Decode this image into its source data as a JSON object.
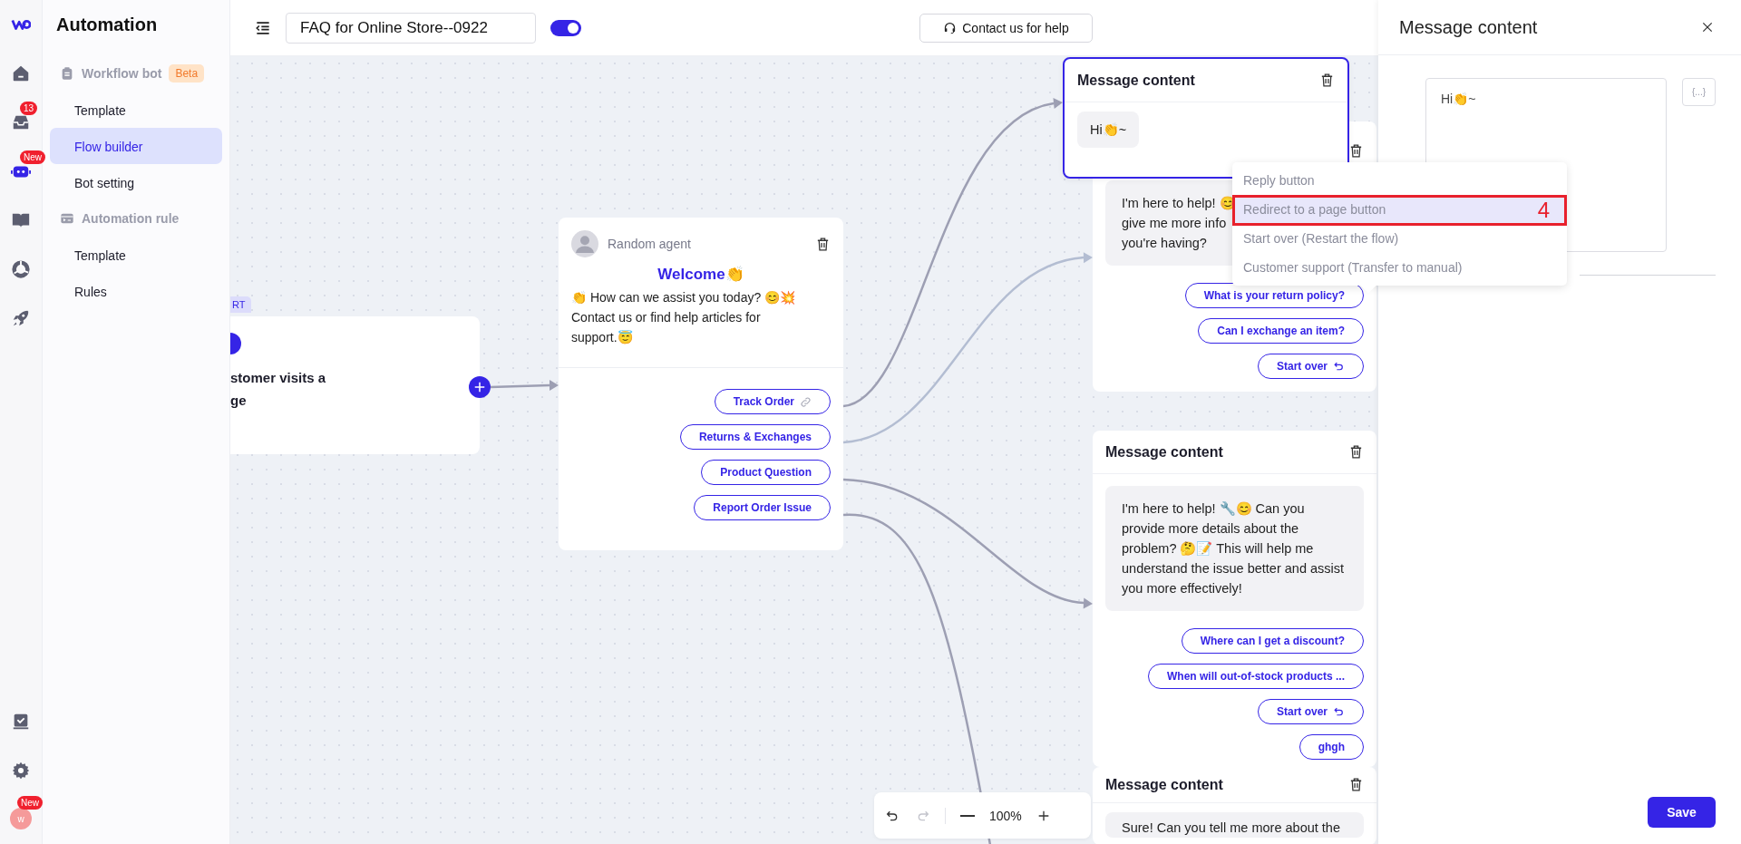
{
  "rail": {
    "items": [
      {
        "kind": "logo"
      },
      {
        "kind": "home",
        "selected": false
      },
      {
        "kind": "inbox",
        "badge": "13",
        "selected": false
      },
      {
        "kind": "bot",
        "badge": "New",
        "selected": true
      },
      {
        "kind": "book",
        "selected": false
      },
      {
        "kind": "chart",
        "selected": false
      },
      {
        "kind": "rocket",
        "selected": false
      }
    ],
    "bottom_items": [
      {
        "kind": "checklist",
        "selected": false
      },
      {
        "kind": "settings",
        "selected": false
      }
    ],
    "avatar": {
      "initial": "w",
      "badge": "New"
    }
  },
  "sidebar": {
    "title": "Automation",
    "groups": [
      {
        "kind": "bot",
        "label": "Workflow bot",
        "tag": "Beta",
        "items": [
          {
            "label": "Template",
            "selected": false
          },
          {
            "label": "Flow builder",
            "selected": true
          },
          {
            "label": "Bot setting",
            "selected": false
          }
        ]
      },
      {
        "kind": "rule",
        "label": "Automation rule",
        "items": [
          {
            "label": "Template",
            "selected": false
          },
          {
            "label": "Rules",
            "selected": false
          }
        ]
      }
    ]
  },
  "toolbar": {
    "flow_name": "FAQ for Online Store--0922",
    "enabled": true,
    "help_button": "Contact us for help"
  },
  "canvas": {
    "start_node": {
      "tag": "RT",
      "lines": [
        "stomer visits a",
        "ge"
      ]
    },
    "nodes": [
      {
        "kind": "message",
        "selected": true,
        "title": "Message content",
        "message": "Hi👏~"
      },
      {
        "kind": "welcome",
        "selected": false,
        "agent": "Random agent",
        "heading": "Welcome👏",
        "message": "👏 How can we assist you today? 😊💥 Contact us or find help articles for support.😇",
        "buttons": [
          {
            "label": "Track Order",
            "kind": "link"
          },
          {
            "label": "Returns & Exchanges",
            "kind": "reply"
          },
          {
            "label": "Product Question",
            "kind": "reply"
          },
          {
            "label": "Report Order Issue",
            "kind": "reply"
          }
        ]
      },
      {
        "kind": "message",
        "selected": false,
        "message": "I'm here to help! 😊\ngive me more info\nyou're having?",
        "buttons": [
          {
            "label": "What is your return policy?",
            "kind": "reply"
          },
          {
            "label": "Can I exchange an item?",
            "kind": "reply"
          },
          {
            "label": "Start over",
            "kind": "restart"
          }
        ]
      },
      {
        "kind": "message",
        "selected": false,
        "title": "Message content",
        "message": "I'm here to help! 🔧😊 Can you provide more details about the problem? 🤔📝 This will help me understand the issue better and assist you more effectively!",
        "buttons": [
          {
            "label": "Where can I get a discount?",
            "kind": "reply"
          },
          {
            "label": "When will out-of-stock products ...",
            "kind": "reply"
          },
          {
            "label": "Start over",
            "kind": "restart"
          },
          {
            "label": "ghgh",
            "kind": "reply"
          }
        ]
      },
      {
        "kind": "message",
        "selected": false,
        "title": "Message content",
        "message": "Sure! Can you tell me more about the"
      }
    ],
    "zoom_controls": [
      {
        "kind": "undo",
        "disabled": false
      },
      {
        "kind": "redo",
        "disabled": true
      },
      {
        "kind": "zoom_out",
        "disabled": false
      },
      {
        "kind": "zoom_in",
        "disabled": false
      }
    ],
    "zoom_text": "100%"
  },
  "button_menu": {
    "items": [
      {
        "label": "Reply button",
        "selected": false
      },
      {
        "label": "Redirect to a page button",
        "selected": true
      },
      {
        "label": "Start over (Restart the flow)",
        "selected": false
      },
      {
        "label": "Customer support (Transfer to manual)",
        "selected": false
      }
    ],
    "annotation": "4"
  },
  "panel": {
    "title": "Message content",
    "message": "Hi👏~",
    "variable_button": "{...}",
    "save_button": "Save"
  }
}
